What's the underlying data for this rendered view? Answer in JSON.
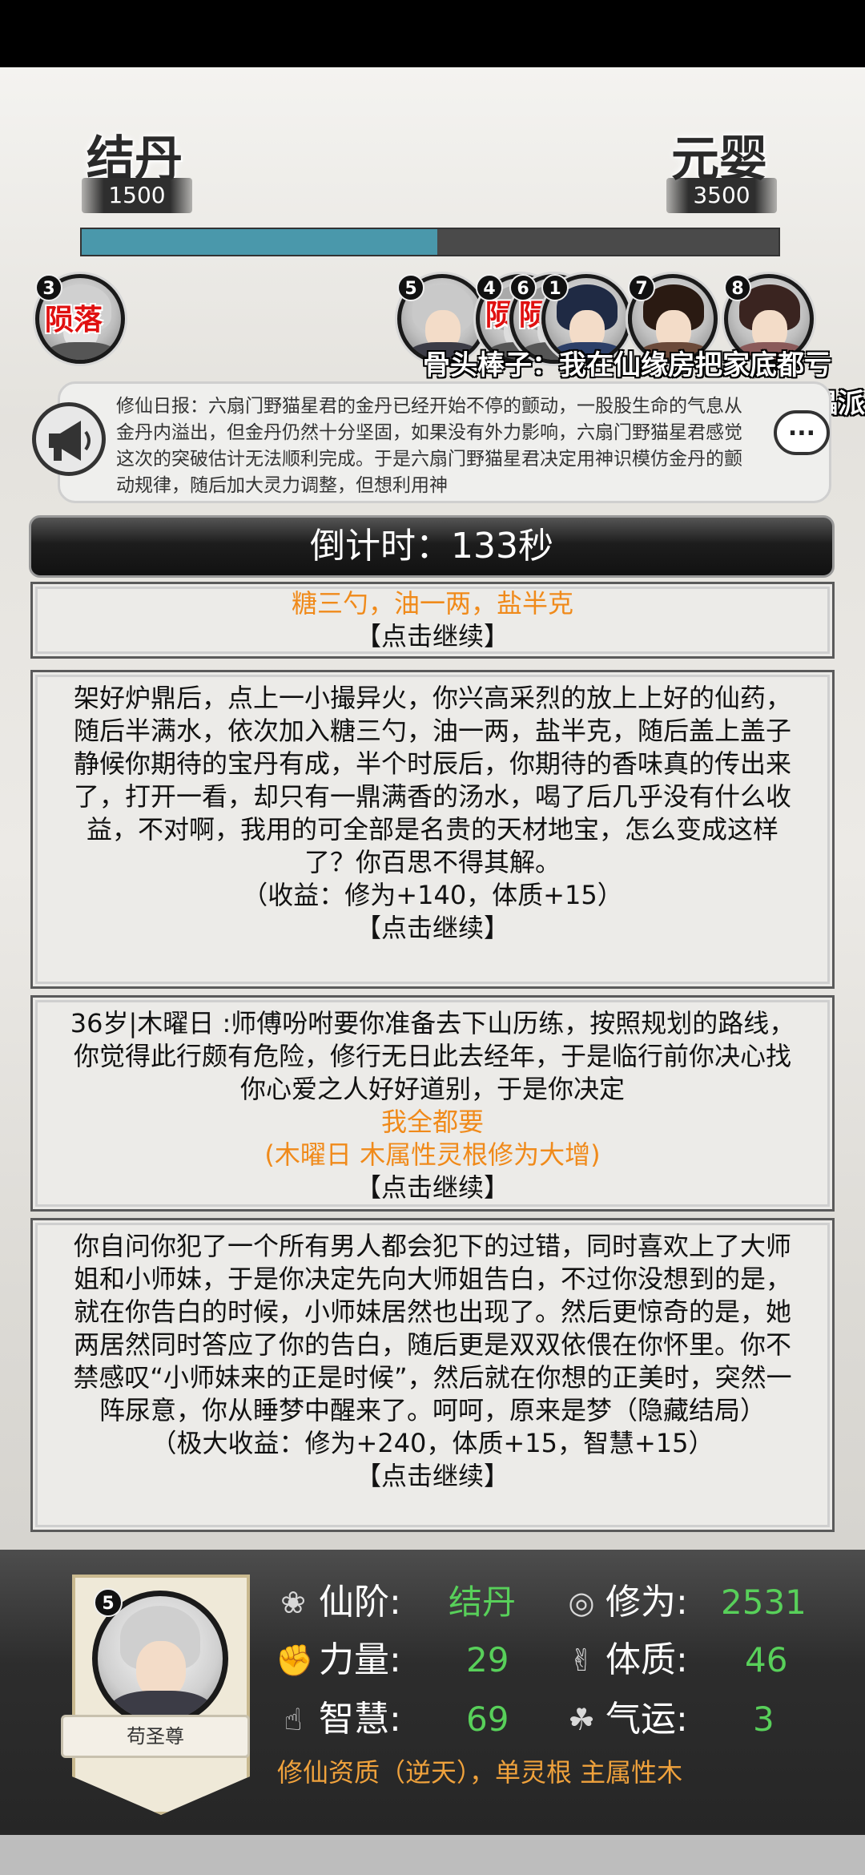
{
  "header": {
    "current_realm": "结丹",
    "current_realm_value": "1500",
    "next_realm": "元婴",
    "next_realm_value": "3500",
    "progress": 0.51
  },
  "players": [
    {
      "rank": "3",
      "status": "陨落"
    },
    {
      "rank": "5"
    },
    {
      "rank": "4",
      "status": "陨"
    },
    {
      "rank": "6",
      "status": "陨"
    },
    {
      "rank": "1"
    },
    {
      "rank": "7"
    },
    {
      "rank": "8"
    }
  ],
  "barrage": {
    "line1": "骨头棒子：我在仙缘房把家底都亏",
    "line2": "傀儡派"
  },
  "daily_report": {
    "text": "修仙日报：六扇门野猫星君的金丹已经开始不停的颤动，一股股生命的气息从金丹内溢出，但金丹仍然十分坚固，如果没有外力影响，六扇门野猫星君感觉这次的突破估计无法顺利完成。于是六扇门野猫星君决定用神识模仿金丹的颤动规律，随后加大灵力调整，但想利用神",
    "chat_icon": "..."
  },
  "countdown": "倒计时：133秒",
  "story": {
    "card1": {
      "orange": "糖三勺，油一两，盐半克",
      "continue": "【点击继续】"
    },
    "card2": {
      "text": "架好炉鼎后，点上一小撮异火，你兴高采烈的放上上好的仙药，随后半满水，依次加入糖三勺，油一两，盐半克，随后盖上盖子静候你期待的宝丹有成，半个时辰后，你期待的香味真的传出来了，打开一看，却只有一鼎满香的汤水，喝了后几乎没有什么收益，不对啊，我用的可全部是名贵的天材地宝，怎么变成这样了？你百思不得其解。",
      "reward": "（收益：修为+140，体质+15）",
      "continue": "【点击继续】"
    },
    "card3": {
      "text": "36岁|木曜日 :师傅吩咐要你准备去下山历练，按照规划的路线，你觉得此行颇有危险，修行无日此去经年，于是临行前你决心找你心爱之人好好道别，于是你决定",
      "choice": "我全都要",
      "bonus": "(木曜日 木属性灵根修为大增)",
      "continue": "【点击继续】"
    },
    "card4": {
      "text": "你自问你犯了一个所有男人都会犯下的过错，同时喜欢上了大师姐和小师妹，于是你决定先向大师姐告白，不过你没想到的是，就在你告白的时候，小师妹居然也出现了。然后更惊奇的是，她两居然同时答应了你的告白，随后更是双双依偎在你怀里。你不禁感叹“小师妹来的正是时候”，然后就在你想的正美时，突然一阵尿意，你从睡梦中醒来了。呵呵，原来是梦（隐藏结局）",
      "reward": "（极大收益：修为+240，体质+15，智慧+15）",
      "continue": "【点击继续】"
    }
  },
  "character": {
    "rank": "5",
    "name": "苟圣尊",
    "stats": {
      "realm_label": "仙阶:",
      "realm_value": "结丹",
      "cultivation_label": "修为:",
      "cultivation_value": "2531",
      "strength_label": "力量:",
      "strength_value": "29",
      "constitution_label": "体质:",
      "constitution_value": "46",
      "wisdom_label": "智慧:",
      "wisdom_value": "69",
      "luck_label": "气运:",
      "luck_value": "3"
    },
    "aptitude": "修仙资质（逆天），单灵根 主属性木"
  },
  "colors": {
    "progress_fill": "#4a98ab",
    "accent_orange": "#f08a1a",
    "stat_green": "#58d05a",
    "dead_red": "#e01010"
  }
}
